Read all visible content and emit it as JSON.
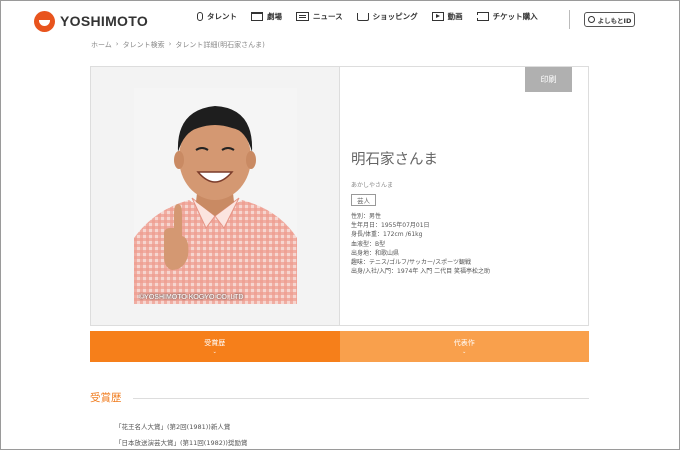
{
  "header": {
    "logo_text": "YOSHIMOTO",
    "nav": [
      {
        "label": "タレント",
        "icon": "microphone-icon"
      },
      {
        "label": "劇場",
        "icon": "stage-icon"
      },
      {
        "label": "ニュース",
        "icon": "news-icon"
      },
      {
        "label": "ショッピング",
        "icon": "cart-icon"
      },
      {
        "label": "動画",
        "icon": "video-icon"
      },
      {
        "label": "チケット購入",
        "icon": "ticket-icon"
      }
    ],
    "login_label": "よしもとID",
    "login_icon": "user-icon"
  },
  "breadcrumb": [
    "ホーム",
    "タレント検索",
    "タレント詳細(明石家さんま)"
  ],
  "profile": {
    "print_label": "印刷",
    "name": "明石家さんま",
    "kana": "あかしやさんま",
    "tag": "芸人",
    "copyright": "©YOSHIMOTO KOGYO CO.,LTD",
    "info": [
      "性別：男性",
      "生年月日：1955年07月01日",
      "身長/体重：172cm /61kg",
      "血液型：B型",
      "出身地：和歌山県",
      "趣味：テニス/ゴルフ/サッカー/スポーツ観戦",
      "出身/入社/入門：1974年 入門 二代目 笑福亭松之助"
    ]
  },
  "tabs": [
    {
      "label": "受賞歴",
      "chevron": "⌄"
    },
    {
      "label": "代表作",
      "chevron": "⌄"
    }
  ],
  "awards": {
    "title": "受賞歴",
    "items": [
      "「花王名人大賞」(第2回(1981))新人賞",
      "「日本放送演芸大賞」(第11回(1982))奨励賞"
    ]
  },
  "colors": {
    "brand": "#e8541d",
    "tab_active": "#f67f1a",
    "tab_inactive": "#f9a04c",
    "section_title": "#f07d20"
  }
}
